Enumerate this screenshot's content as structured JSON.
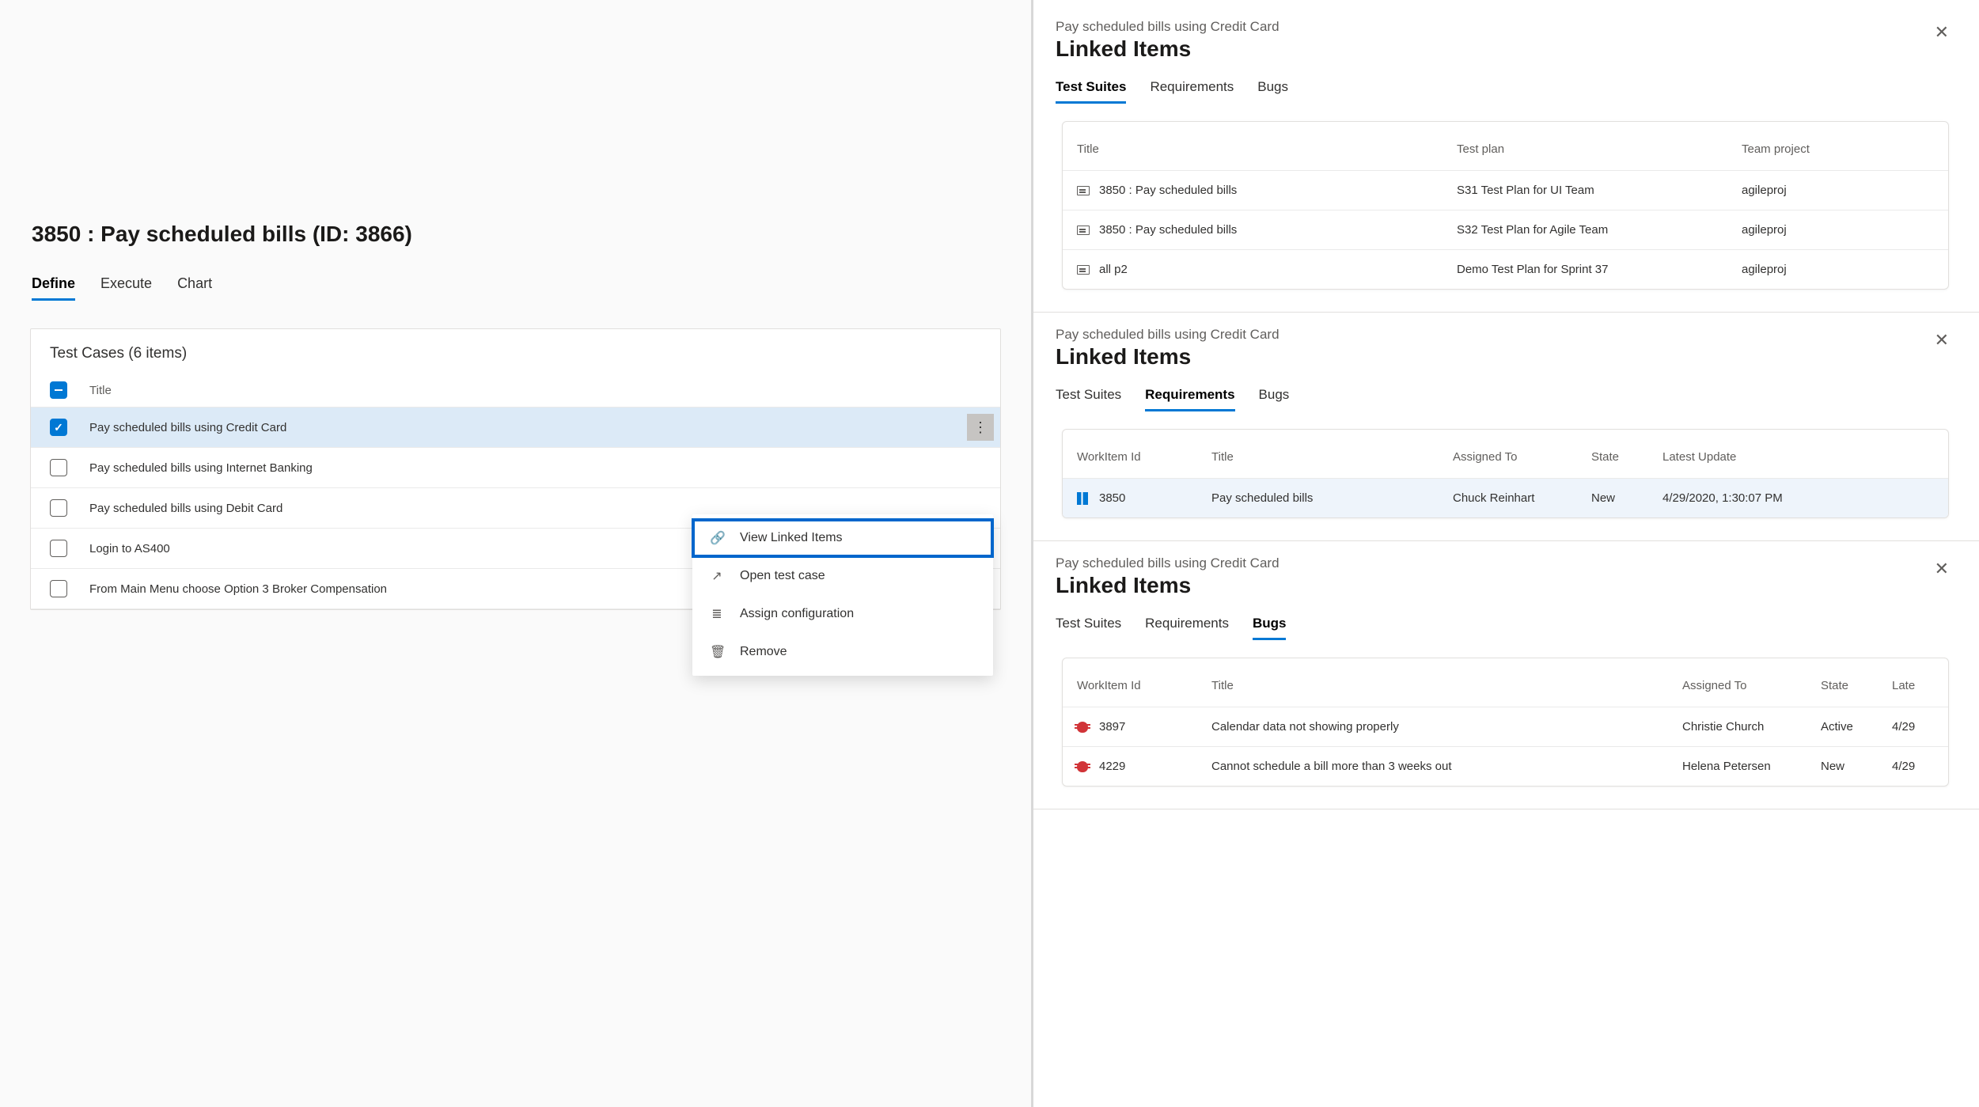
{
  "left": {
    "title": "3850 : Pay scheduled bills (ID: 3866)",
    "tabs": [
      "Define",
      "Execute",
      "Chart"
    ],
    "active_tab": 0,
    "listHeader": "Test Cases (6 items)",
    "colTitle": "Title",
    "rows": [
      {
        "title": "Pay scheduled bills using Credit Card",
        "checked": true,
        "selected": true,
        "more": true
      },
      {
        "title": "Pay scheduled bills using Internet Banking"
      },
      {
        "title": "Pay scheduled bills using Debit Card"
      },
      {
        "title": "Login to AS400"
      },
      {
        "title": "From Main Menu choose Option 3 Broker Compensation"
      }
    ],
    "contextMenu": [
      {
        "icon": "🔗",
        "label": "View Linked Items",
        "hl": true
      },
      {
        "icon": "↗",
        "label": "Open test case"
      },
      {
        "icon": "≣",
        "label": "Assign configuration"
      },
      {
        "icon": "🗑",
        "label": "Remove"
      }
    ]
  },
  "panels": [
    {
      "subtitle": "Pay scheduled bills using Credit Card",
      "heading": "Linked Items",
      "tabs": [
        "Test Suites",
        "Requirements",
        "Bugs"
      ],
      "active": 0,
      "class": "p1",
      "headers": [
        "Title",
        "Test plan",
        "Team project"
      ],
      "rows": [
        {
          "iconType": "suite",
          "cells": [
            "3850 : Pay scheduled bills",
            "S31 Test Plan for UI Team",
            "agileproj"
          ]
        },
        {
          "iconType": "suite",
          "cells": [
            "3850 : Pay scheduled bills",
            "S32 Test Plan for Agile Team",
            "agileproj"
          ]
        },
        {
          "iconType": "suite",
          "cells": [
            "all p2",
            "Demo Test Plan for Sprint 37",
            "agileproj"
          ]
        }
      ]
    },
    {
      "subtitle": "Pay scheduled bills using Credit Card",
      "heading": "Linked Items",
      "tabs": [
        "Test Suites",
        "Requirements",
        "Bugs"
      ],
      "active": 1,
      "class": "p2",
      "headers": [
        "WorkItem Id",
        "Title",
        "Assigned To",
        "State",
        "Latest Update"
      ],
      "rows": [
        {
          "iconType": "story",
          "sel": true,
          "cells": [
            "3850",
            "Pay scheduled bills",
            "Chuck Reinhart",
            "New",
            "4/29/2020, 1:30:07 PM"
          ]
        }
      ]
    },
    {
      "subtitle": "Pay scheduled bills using Credit Card",
      "heading": "Linked Items",
      "tabs": [
        "Test Suites",
        "Requirements",
        "Bugs"
      ],
      "active": 2,
      "class": "p3",
      "headers": [
        "WorkItem Id",
        "Title",
        "Assigned To",
        "State",
        "Late"
      ],
      "rows": [
        {
          "iconType": "bug",
          "cells": [
            "3897",
            "Calendar data not showing properly",
            "Christie Church",
            "Active",
            "4/29"
          ]
        },
        {
          "iconType": "bug",
          "cells": [
            "4229",
            "Cannot schedule a bill more than 3 weeks out",
            "Helena Petersen",
            "New",
            "4/29"
          ]
        }
      ]
    }
  ]
}
